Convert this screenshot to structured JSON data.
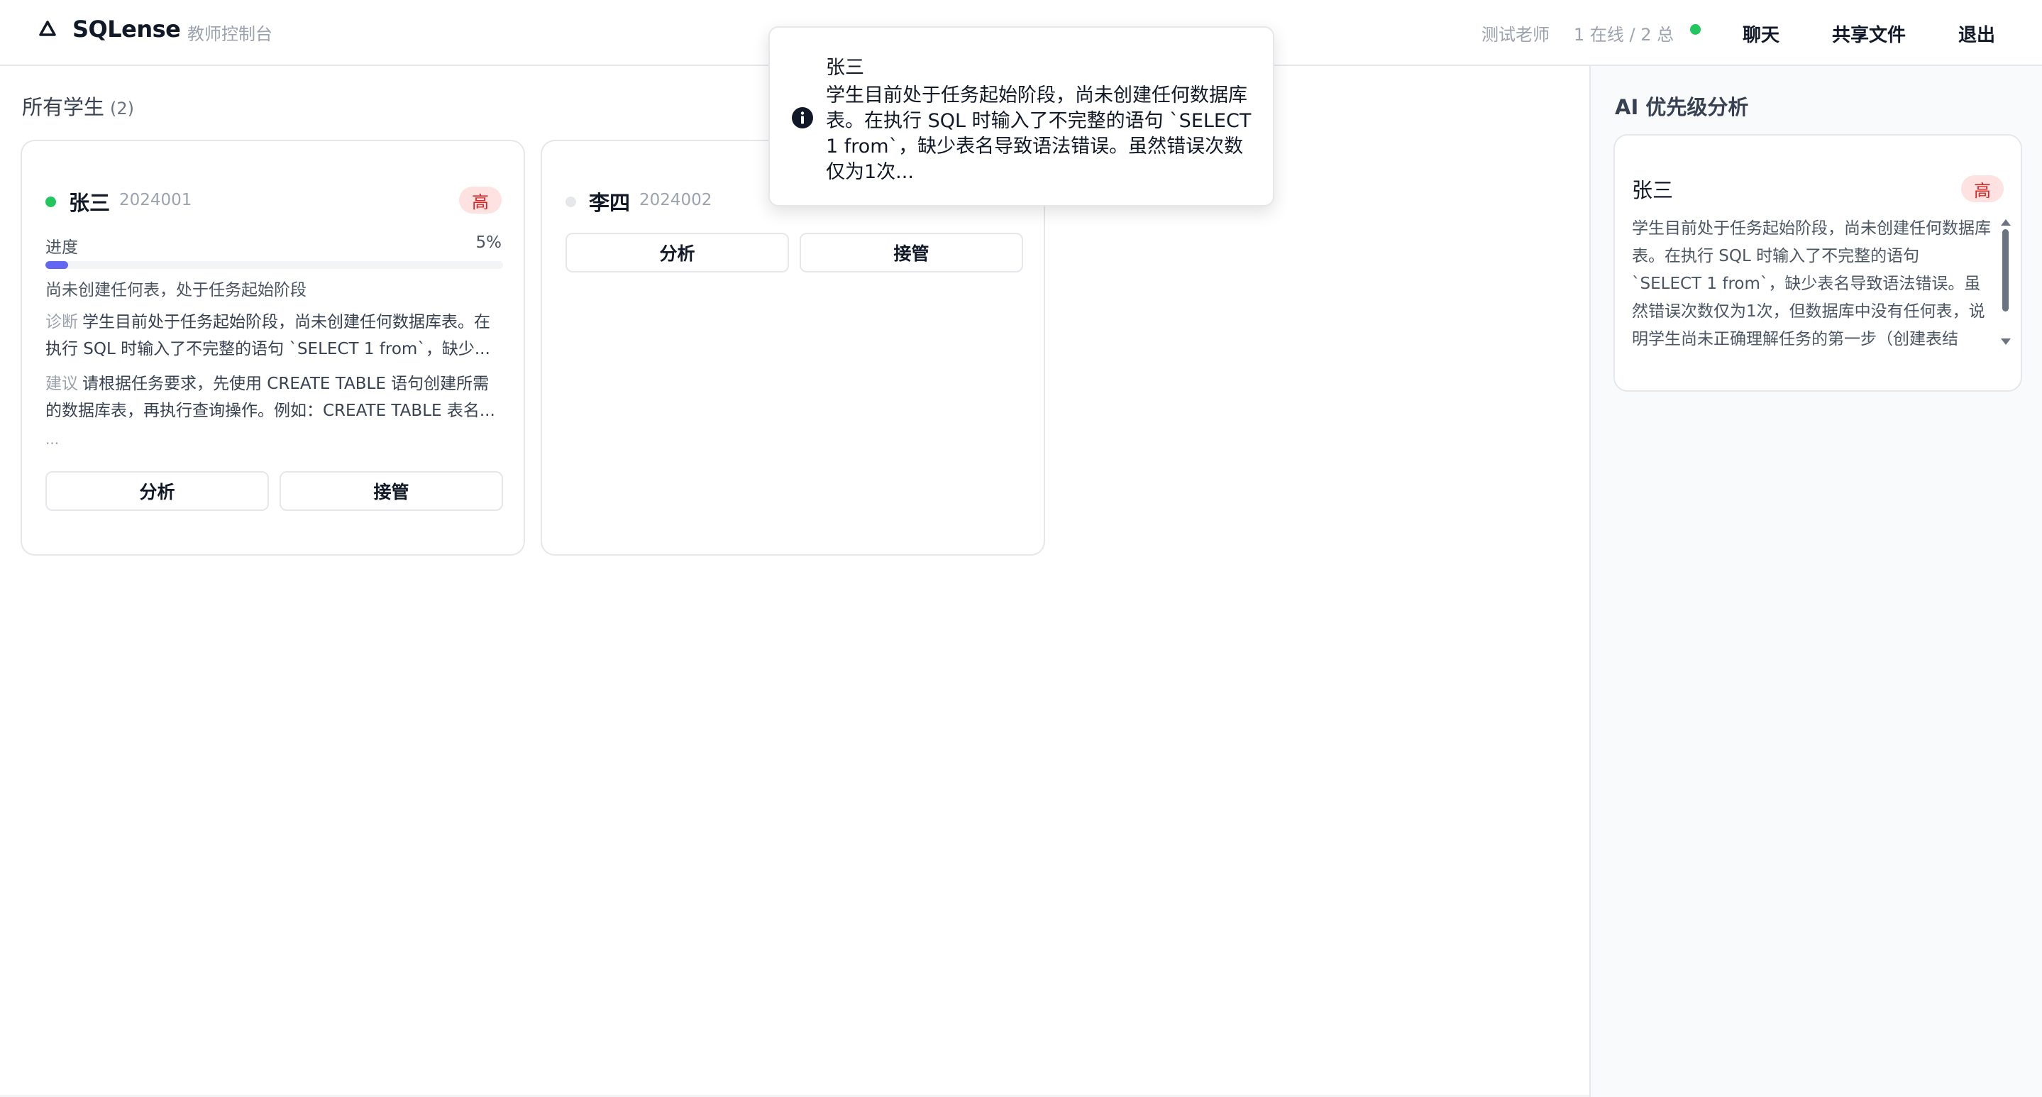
{
  "header": {
    "app_name": "SQLense",
    "app_subtitle": "教师控制台",
    "teacher_name": "测试老师",
    "online_status": "1 在线 / 2 总",
    "buttons": {
      "chat": "聊天",
      "share_files": "共享文件",
      "logout": "退出"
    },
    "colors": {
      "online": "#22c55e"
    }
  },
  "students_section": {
    "title": "所有学生",
    "count": "(2)",
    "students": [
      {
        "name": "张三",
        "id": "2024001",
        "online": true,
        "priority": "高",
        "progress_label": "进度",
        "progress_pct": "5%",
        "progress_value": 0.05,
        "status_text": "尚未创建任何表，处于任务起始阶段",
        "diagnosis_label": "诊断",
        "diagnosis": "学生目前处于任务起始阶段，尚未创建任何数据库表。在执行 SQL 时输入了不完整的语句 `SELECT 1 from`，缺少...",
        "suggestion_label": "建议",
        "suggestion": "请根据任务要求，先使用 CREATE TABLE 语句创建所需的数据库表，再执行查询操作。例如：CREATE TABLE 表名...",
        "more": "...",
        "analyze_label": "分析",
        "takeover_label": "接管"
      },
      {
        "name": "李四",
        "id": "2024002",
        "online": false,
        "analyze_label": "分析",
        "takeover_label": "接管"
      }
    ]
  },
  "ai_panel": {
    "title": "AI 优先级分析",
    "entry": {
      "name": "张三",
      "priority": "高",
      "text": "学生目前处于任务起始阶段，尚未创建任何数据库表。在执行 SQL 时输入了不完整的语句 `SELECT 1 from`，缺少表名导致语法错误。虽然错误次数仅为1次，但数据库中没有任何表，说明学生尚未正确理解任务的第一步（创建表结"
    }
  },
  "toast": {
    "title": "张三",
    "body": "学生目前处于任务起始阶段，尚未创建任何数据库表。在执行 SQL 时输入了不完整的语句 `SELECT 1 from`，缺少表名导致语法错误。虽然错误次数仅为1次..."
  },
  "colors": {
    "priority_high_bg": "#fee2e2",
    "priority_high_fg": "#dc2626",
    "progress": "#6366f1",
    "offline": "#e5e7eb"
  }
}
